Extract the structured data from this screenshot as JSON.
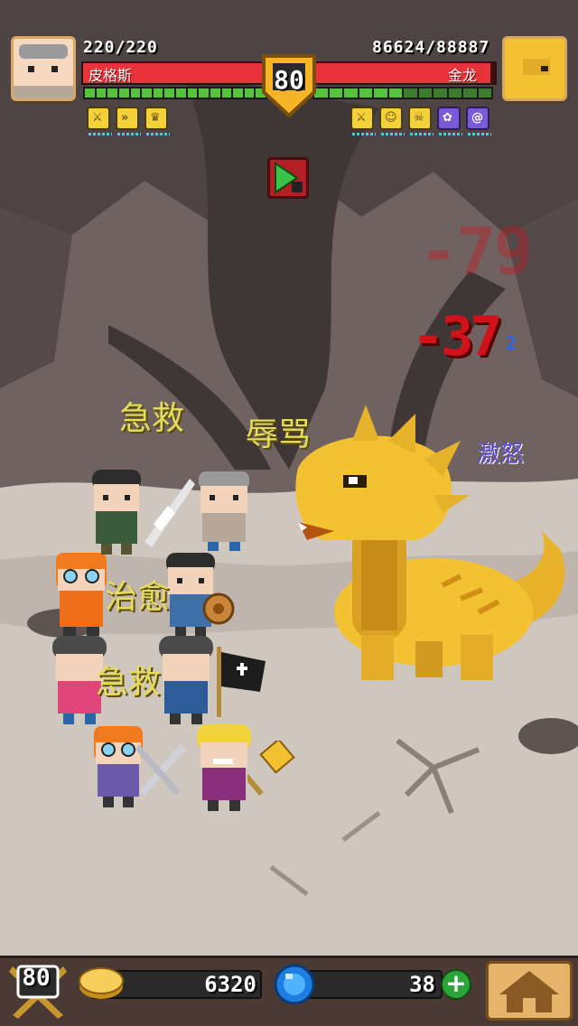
{
  "hud": {
    "player": {
      "name": "皮格斯",
      "hp_text": "220/220",
      "hp_fraction": 1.0
    },
    "boss": {
      "name": "金龙",
      "hp_text": "86624/88887",
      "hp_fraction": 0.975
    },
    "round": "80",
    "player_buffs": [
      "sword-buff-icon",
      "speed-buff-icon",
      "crown-buff-icon"
    ],
    "boss_buffs": [
      "sword-buff-icon",
      "face-buff-icon",
      "skull-buff-icon",
      "pinwheel-buff-icon",
      "swirl-buff-icon"
    ],
    "speed_button": "play-speed-icon"
  },
  "floating_text": {
    "rescue_1": "急救",
    "insult": "辱骂",
    "rage": "激怒",
    "heal": "治愈",
    "rescue_2": "急救",
    "damage_faded": "-79",
    "damage_main": "-37",
    "damage_sup": "2"
  },
  "bottom": {
    "level": "80",
    "gold": "6320",
    "gems": "38",
    "plus": "+"
  },
  "colors": {
    "hp_red": "#e8333b",
    "energy_green": "#56c43a",
    "dragon_gold": "#f2c233",
    "text_yellow": "#e6dc5b"
  }
}
